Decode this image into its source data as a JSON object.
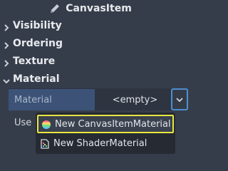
{
  "header": {
    "title": "CanvasItem",
    "icon": "pencil-icon"
  },
  "sections": [
    {
      "label": "Visibility",
      "expanded": false
    },
    {
      "label": "Ordering",
      "expanded": false
    },
    {
      "label": "Texture",
      "expanded": false
    },
    {
      "label": "Material",
      "expanded": true
    }
  ],
  "material_property": {
    "name": "Material",
    "value": "<empty>",
    "dropdown_icon": "chevron-down-icon"
  },
  "next_property_label_partial": "Use",
  "popup_menu": {
    "items": [
      {
        "label": "New CanvasItemMaterial",
        "icon": "canvas-item-material-icon",
        "selected": true
      },
      {
        "label": "New ShaderMaterial",
        "icon": "shader-material-icon",
        "selected": false
      }
    ]
  },
  "colors": {
    "background": "#363d4a",
    "property_name_bg": "#3c5377",
    "focus_border": "#4d8fd1",
    "selection_border": "#e8e640",
    "popup_bg": "#252a33"
  }
}
